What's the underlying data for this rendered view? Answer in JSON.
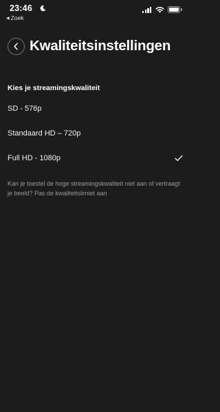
{
  "status_bar": {
    "time": "23:46",
    "back_app_label": "Zoek",
    "icons": [
      "moon-icon",
      "signal-icon",
      "wifi-icon",
      "battery-icon"
    ],
    "battery_level": 1.0
  },
  "header": {
    "back_icon": "chevron-left-icon",
    "title": "Kwaliteitsinstellingen"
  },
  "quality": {
    "heading": "Kies je streamingskwaliteit",
    "options": [
      {
        "label": "SD - 576p",
        "selected": false
      },
      {
        "label": "Standaard HD – 720p",
        "selected": false
      },
      {
        "label": "Full HD - 1080p",
        "selected": true
      }
    ],
    "note": "Kan je toestel de hoge streamingskwaliteit niet aan of vertraagt je beeld? Pas de kwaliteitslimiet aan"
  },
  "colors": {
    "background": "#1c1c1c",
    "text": "#ffffff",
    "muted_text": "#9a9a9a"
  }
}
